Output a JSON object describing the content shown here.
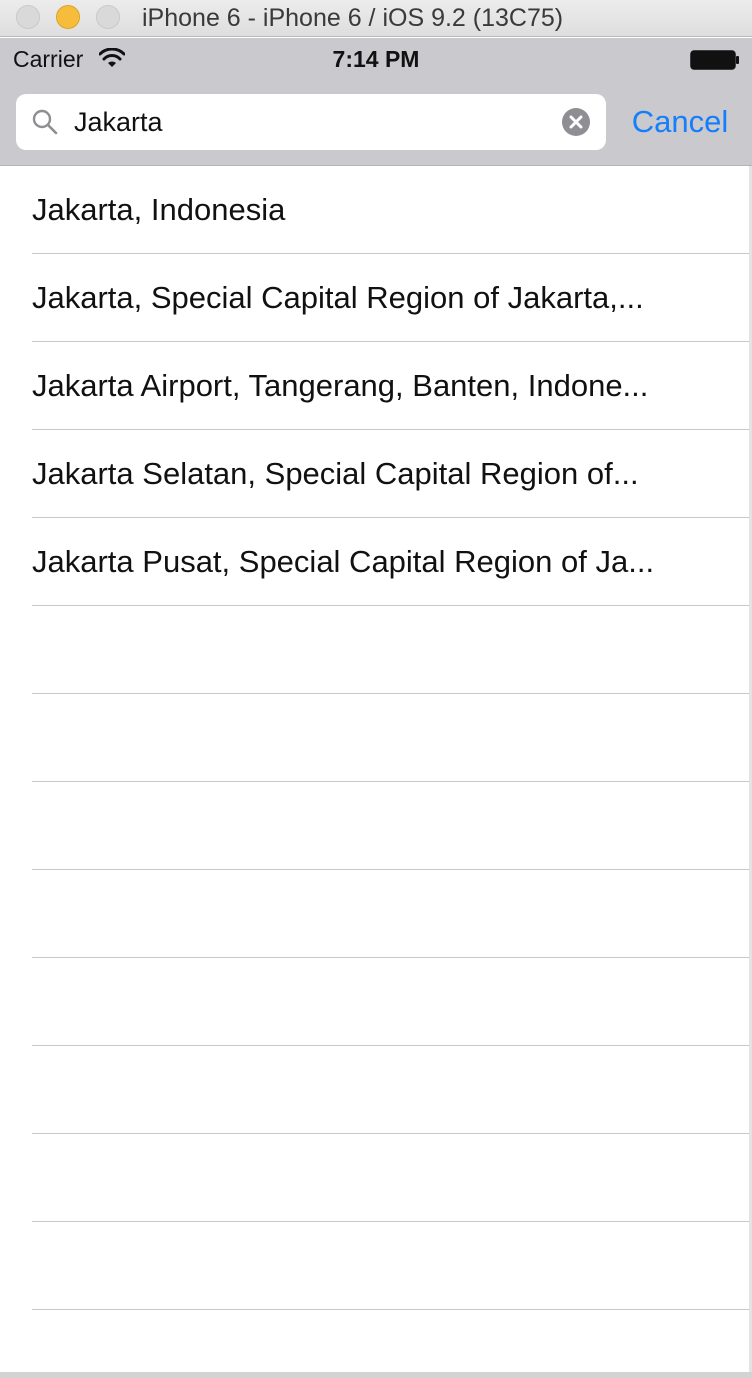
{
  "window": {
    "title": "iPhone 6 - iPhone 6 / iOS 9.2 (13C75)"
  },
  "status_bar": {
    "carrier": "Carrier",
    "time": "7:14 PM",
    "wifi_icon": "wifi-icon",
    "battery_icon": "battery-icon"
  },
  "search": {
    "value": "Jakarta",
    "search_icon": "search-icon",
    "clear_icon": "clear-icon",
    "cancel_label": "Cancel"
  },
  "results": [
    "Jakarta, Indonesia",
    "Jakarta, Special Capital Region of Jakarta,...",
    "Jakarta Airport, Tangerang, Banten, Indone...",
    "Jakarta Selatan, Special Capital Region of...",
    "Jakarta Pusat, Special Capital Region of Ja...",
    "",
    "",
    "",
    "",
    "",
    "",
    "",
    "",
    ""
  ],
  "colors": {
    "accent": "#147efb",
    "search_bar_background": "#c9c9ce",
    "separator": "#c8c7cc"
  }
}
